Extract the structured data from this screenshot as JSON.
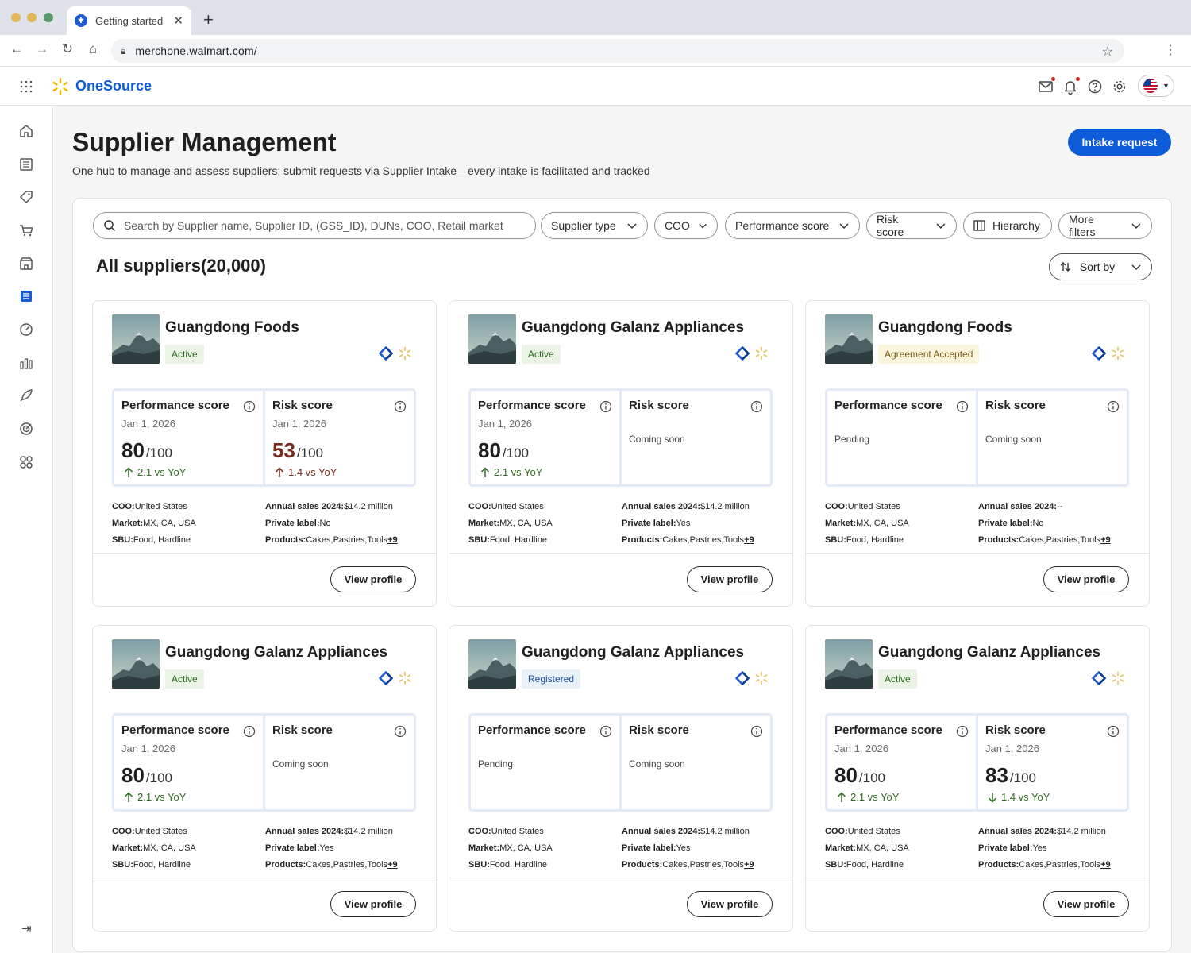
{
  "browser": {
    "tab_title": "Getting started",
    "url": "merchone.walmart.com/"
  },
  "app": {
    "brand": "OneSource"
  },
  "page": {
    "title": "Supplier Management",
    "subtitle": "One hub to manage and assess suppliers; submit requests via Supplier Intake—every intake is facilitated and tracked",
    "intake_label": "Intake request"
  },
  "search": {
    "placeholder": "Search by Supplier name, Supplier ID, (GSS_ID), DUNs, COO, Retail market"
  },
  "filters": [
    "Supplier type",
    "COO",
    "Performance score",
    "Risk score",
    "Hierarchy",
    "More filters"
  ],
  "list": {
    "heading": "All suppliers(20,000)",
    "sort_label": "Sort by"
  },
  "labels": {
    "performance": "Performance score",
    "risk": "Risk score",
    "out_of": "/100",
    "coo": "COO:",
    "market": "Market:",
    "sbu": "SBU:",
    "annual_sales": "Annual sales 2024:",
    "private_label": "Private label:",
    "products": "Products:",
    "view_profile": "View profile"
  },
  "cards": [
    {
      "name": "Guangdong Foods",
      "status": "Active",
      "perf": {
        "date": "Jan 1, 2026",
        "value": "80",
        "trend": "2.1 vs YoY",
        "note": ""
      },
      "risk": {
        "date": "Jan 1, 2026",
        "value": "53",
        "trend": "1.4 vs YoY",
        "note": ""
      },
      "coo": "United States",
      "market": "MX, CA, USA",
      "sbu": "Food, Hardline",
      "sales": "$14.2 million",
      "private_label": "No",
      "products": "Cakes,Pastries,Tools",
      "more": "+9"
    },
    {
      "name": "Guangdong Galanz Appliances",
      "status": "Active",
      "perf": {
        "date": "Jan 1, 2026",
        "value": "80",
        "trend": "2.1 vs YoY",
        "note": ""
      },
      "risk": {
        "date": "",
        "value": "",
        "trend": "",
        "note": "Coming soon"
      },
      "coo": "United States",
      "market": "MX, CA, USA",
      "sbu": "Food, Hardline",
      "sales": "$14.2 million",
      "private_label": "Yes",
      "products": "Cakes,Pastries,Tools",
      "more": "+9"
    },
    {
      "name": "Guangdong Foods",
      "status": "Agreement Accepted",
      "perf": {
        "date": "",
        "value": "",
        "trend": "",
        "note": "Pending"
      },
      "risk": {
        "date": "",
        "value": "",
        "trend": "",
        "note": "Coming soon"
      },
      "coo": "United States",
      "market": "MX, CA, USA",
      "sbu": "Food, Hardline",
      "sales": "--",
      "private_label": "No",
      "products": "Cakes,Pastries,Tools",
      "more": "+9"
    },
    {
      "name": "Guangdong Galanz Appliances",
      "status": "Active",
      "perf": {
        "date": "Jan 1, 2026",
        "value": "80",
        "trend": "2.1 vs YoY",
        "note": ""
      },
      "risk": {
        "date": "",
        "value": "",
        "trend": "",
        "note": "Coming soon"
      },
      "coo": "United States",
      "market": "MX, CA, USA",
      "sbu": "Food, Hardline",
      "sales": "$14.2 million",
      "private_label": "Yes",
      "products": "Cakes,Pastries,Tools",
      "more": "+9"
    },
    {
      "name": "Guangdong Galanz Appliances",
      "status": "Registered",
      "perf": {
        "date": "",
        "value": "",
        "trend": "",
        "note": "Pending"
      },
      "risk": {
        "date": "",
        "value": "",
        "trend": "",
        "note": "Coming soon"
      },
      "coo": "United States",
      "market": "MX, CA, USA",
      "sbu": "Food, Hardline",
      "sales": "$14.2 million",
      "private_label": "Yes",
      "products": "Cakes,Pastries,Tools",
      "more": "+9"
    },
    {
      "name": "Guangdong Galanz Appliances",
      "status": "Active",
      "perf": {
        "date": "Jan 1, 2026",
        "value": "80",
        "trend": "2.1 vs YoY",
        "note": ""
      },
      "risk": {
        "date": "Jan 1, 2026",
        "value": "83",
        "trend": "1.4 vs YoY",
        "note": ""
      },
      "coo": "United States",
      "market": "MX, CA, USA",
      "sbu": "Food, Hardline",
      "sales": "$14.2 million",
      "private_label": "Yes",
      "products": "Cakes,Pastries,Tools",
      "more": "+9"
    }
  ],
  "colors": {
    "primary": "#0d5bd9",
    "spark": "#f2b705",
    "positive": "#2e6b20",
    "risk": "#7a2b1c"
  }
}
